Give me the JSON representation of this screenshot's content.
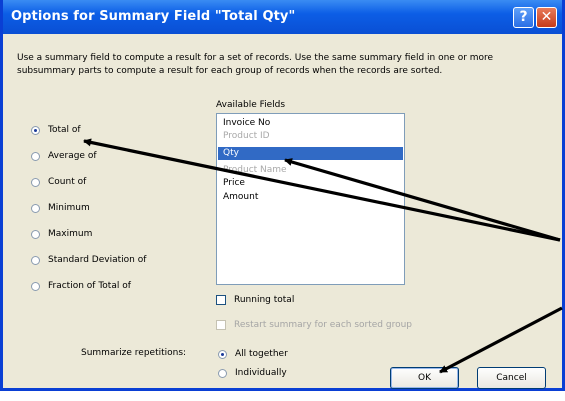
{
  "window": {
    "title": "Options for Summary Field \"Total Qty\"",
    "help_glyph": "?",
    "close_glyph": "✕"
  },
  "description": "Use a summary field to compute a result for a set of records. Use the same summary field in one or more subsummary parts to compute a result for each group of records when the records are sorted.",
  "summary_types": [
    {
      "label": "Total of",
      "checked": true
    },
    {
      "label": "Average of",
      "checked": false
    },
    {
      "label": "Count of",
      "checked": false
    },
    {
      "label": "Minimum",
      "checked": false
    },
    {
      "label": "Maximum",
      "checked": false
    },
    {
      "label": "Standard Deviation of",
      "checked": false
    },
    {
      "label": "Fraction of Total of",
      "checked": false
    }
  ],
  "available_fields": {
    "label": "Available Fields",
    "items": [
      {
        "label": "Invoice No",
        "state": "normal"
      },
      {
        "label": "Product ID",
        "state": "disabled"
      },
      {
        "label": "Qty",
        "state": "selected"
      },
      {
        "label": "Product Name",
        "state": "disabled"
      },
      {
        "label": "Price",
        "state": "normal"
      },
      {
        "label": "Amount",
        "state": "normal"
      }
    ]
  },
  "options": {
    "running_total": "Running total",
    "restart_summary": "Restart summary for each sorted group"
  },
  "repetitions": {
    "label": "Summarize repetitions:",
    "choices": [
      {
        "label": "All together",
        "checked": true
      },
      {
        "label": "Individually",
        "checked": false
      }
    ]
  },
  "buttons": {
    "ok": "OK",
    "cancel": "Cancel"
  },
  "colors": {
    "title_bar": "#0a4fd4",
    "selection": "#316ac5",
    "dialog_bg": "#ece9d8",
    "arrow": "#000000"
  }
}
